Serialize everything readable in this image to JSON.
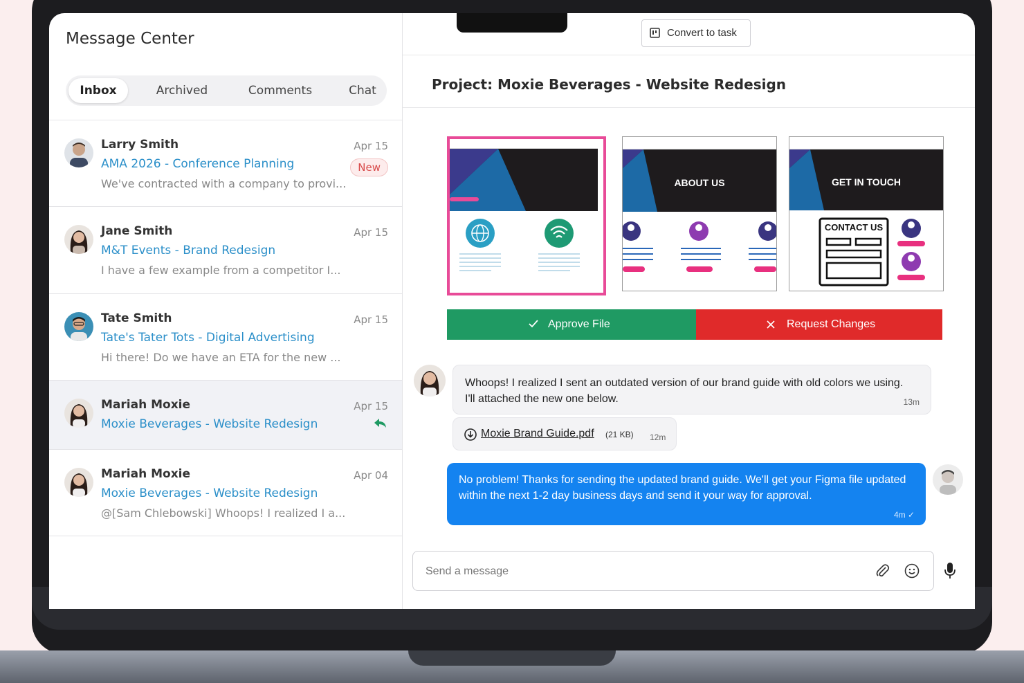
{
  "sidebar": {
    "title": "Message Center",
    "tabs": [
      {
        "label": "Inbox"
      },
      {
        "label": "Archived"
      },
      {
        "label": "Comments"
      },
      {
        "label": "Chat"
      }
    ],
    "threads": [
      {
        "name": "Larry Smith",
        "subject": "AMA 2026 - Conference Planning",
        "preview": "We've contracted with a company to provi...",
        "date": "Apr 15",
        "badge": "New"
      },
      {
        "name": "Jane Smith",
        "subject": "M&T Events - Brand Redesign",
        "preview": "I have a few example from a competitor I...",
        "date": "Apr 15"
      },
      {
        "name": "Tate Smith",
        "subject": "Tate's Tater Tots - Digital Advertising",
        "preview": "Hi there! Do we have an ETA for the new ...",
        "date": "Apr 15"
      },
      {
        "name": "Mariah Moxie",
        "subject": "Moxie Beverages - Website Redesign",
        "preview": "",
        "date": "Apr 15",
        "icon": "reply-icon"
      },
      {
        "name": "Mariah Moxie",
        "subject": "Moxie Beverages - Website Redesign",
        "preview": "@[Sam Chlebowski] Whoops! I realized I a...",
        "date": "Apr 04"
      }
    ]
  },
  "conversation": {
    "convert_label": "Convert to task",
    "project_title": "Project: Moxie Beverages - Website Redesign",
    "mockups": [
      {
        "heading": ""
      },
      {
        "heading": "ABOUT US"
      },
      {
        "heading": "GET IN TOUCH",
        "sub": "CONTACT US"
      }
    ],
    "approve_label": "Approve File",
    "reject_label": "Request Changes",
    "messages": {
      "incoming_text": "Whoops! I realized I sent an outdated version of our brand guide with old colors we using. I'll attached the new one below.",
      "incoming_time": "13m",
      "file_name": "Moxie Brand Guide.pdf",
      "file_size": "(21 KB)",
      "file_time": "12m",
      "outgoing_text": "No problem! Thanks for sending the updated brand guide. We'll get your Figma file updated within the next 1-2 day business days and send it your way for approval.",
      "outgoing_time": "4m ✓"
    },
    "composer_placeholder": "Send a message"
  },
  "colors": {
    "accent_blue": "#1483f0",
    "link_blue": "#2b8fc9",
    "approve_green": "#1f9a63",
    "reject_red": "#e02a2a",
    "highlight_pink": "#e84b98"
  }
}
